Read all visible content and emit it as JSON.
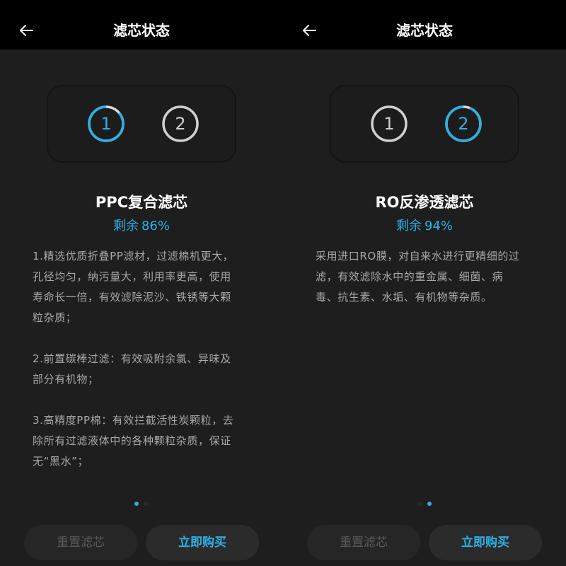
{
  "colors": {
    "accent": "#2cb0e6",
    "ring_inactive": "#cfcfcf",
    "background": "#1e1e1e",
    "header": "#000000"
  },
  "screens": [
    {
      "header": {
        "title": "滤芯状态",
        "back_icon": "arrow-left-icon"
      },
      "filters": [
        {
          "number": "1",
          "active": true,
          "remaining_fraction": 0.86
        },
        {
          "number": "2",
          "active": false,
          "remaining_fraction": 1
        }
      ],
      "filter_name": "PPC复合滤芯",
      "remaining_label": "剩余",
      "remaining_value": "86%",
      "description": [
        "1.精选优质折叠PP滤材，过滤棉机更大，",
        "孔径均匀，纳污量大，利用率更高，使用",
        "寿命长一倍，有效滤除泥沙、铁锈等大颗",
        "粒杂质；",
        "",
        "2.前置碳棒过滤：有效吸附余氯、异味及",
        "部分有机物；",
        "",
        "3.高精度PP棉：有效拦截活性炭颗粒，去",
        "除所有过滤液体中的各种颗粒杂质，保证",
        "无“黑水”；"
      ],
      "page_indicator": {
        "current": 1,
        "total": 2
      },
      "buttons": {
        "reset": "重置滤芯",
        "buy": "立即购买"
      }
    },
    {
      "header": {
        "title": "滤芯状态",
        "back_icon": "arrow-left-icon"
      },
      "filters": [
        {
          "number": "1",
          "active": false,
          "remaining_fraction": 1
        },
        {
          "number": "2",
          "active": true,
          "remaining_fraction": 0.94
        }
      ],
      "filter_name": "RO反渗透滤芯",
      "remaining_label": "剩余",
      "remaining_value": "94%",
      "description": [
        "采用进口RO膜，对自来水进行更精细的过",
        "滤，有效滤除水中的重金属、细菌、病",
        "毒、抗生素、水垢、有机物等杂质。"
      ],
      "page_indicator": {
        "current": 2,
        "total": 2
      },
      "buttons": {
        "reset": "重置滤芯",
        "buy": "立即购买"
      }
    }
  ]
}
